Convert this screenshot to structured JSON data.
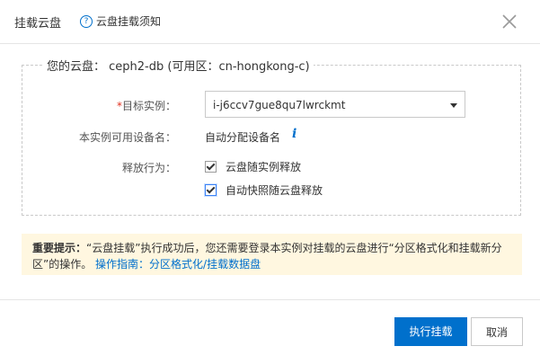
{
  "header": {
    "title": "挂载云盘",
    "help_icon": "question-icon",
    "help_text": "云盘挂载须知",
    "close_icon": "close-icon"
  },
  "disk": {
    "legend": "您的云盘： ceph2-db (可用区：cn-hongkong-c)"
  },
  "form": {
    "target_label_required": "*",
    "target_label": "目标实例：",
    "target_value": "i-j6ccv7gue8qu7lwrckmt",
    "device_label": "本实例可用设备名：",
    "device_value": "自动分配设备名",
    "release_label": "释放行为：",
    "options": [
      {
        "label": "云盘随实例释放",
        "checked": true
      },
      {
        "label": "自动快照随云盘释放",
        "checked": true
      }
    ]
  },
  "notice": {
    "bold_prefix": "重要提示：",
    "text": "“云盘挂载”执行成功后，您还需要登录本实例对挂载的云盘进行“分区格式化和挂载新分区”的操作。",
    "link": "操作指南：分区格式化/挂载数据盘"
  },
  "footer": {
    "confirm_label": "执行挂载",
    "cancel_label": "取消"
  },
  "colors": {
    "accent": "#0070cc",
    "notice_bg": "#fff7e0",
    "required": "#e0301e"
  }
}
